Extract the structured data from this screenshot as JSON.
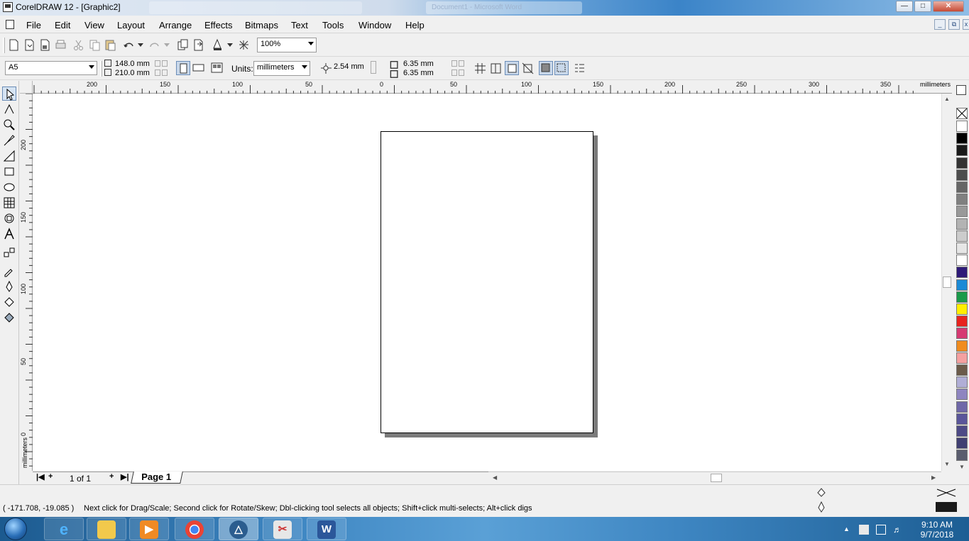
{
  "window": {
    "title": "CorelDRAW 12 - [Graphic2]",
    "ghost_tab": "Document1 - Microsoft Word"
  },
  "menu": [
    "File",
    "Edit",
    "View",
    "Layout",
    "Arrange",
    "Effects",
    "Bitmaps",
    "Text",
    "Tools",
    "Window",
    "Help"
  ],
  "toolbar": {
    "zoom": "100%"
  },
  "property_bar": {
    "paper_size": "A5",
    "width": "148.0 mm",
    "height": "210.0 mm",
    "units_label": "Units:",
    "units": "millimeters",
    "nudge": "2.54 mm",
    "dup_x": "6.35 mm",
    "dup_y": "6.35 mm"
  },
  "rulers": {
    "horizontal_labels": [
      "200",
      "150",
      "100",
      "50",
      "0",
      "50",
      "100",
      "150",
      "200",
      "250",
      "300",
      "350"
    ],
    "vertical_labels": [
      "200",
      "150",
      "100",
      "50",
      "0"
    ],
    "unit": "millimeters"
  },
  "page_nav": {
    "count": "1 of 1",
    "tab": "Page 1"
  },
  "palette": [
    "#ffffff",
    "#000000",
    "#1a1a1a",
    "#333333",
    "#4d4d4d",
    "#666666",
    "#808080",
    "#999999",
    "#b3b3b3",
    "#cccccc",
    "#e6e6e6",
    "#ffffff",
    "#2e1a78",
    "#1b8ad6",
    "#1a9a4a",
    "#ffee00",
    "#e8231e",
    "#d63a72",
    "#f08c1e",
    "#f4a0a0",
    "#6b5b4a",
    "#b0aed6",
    "#8e85c0",
    "#6f68a8",
    "#5a569a",
    "#4d4a86",
    "#403f72",
    "#5a5d6e"
  ],
  "status": {
    "coords": "( -171.708, -19.085 )",
    "message": "Next click for Drag/Scale; Second click for Rotate/Skew; Dbl-clicking tool selects all objects; Shift+click multi-selects; Alt+click digs"
  },
  "taskbar": {
    "time": "9:10 AM",
    "date": "9/7/2018"
  }
}
